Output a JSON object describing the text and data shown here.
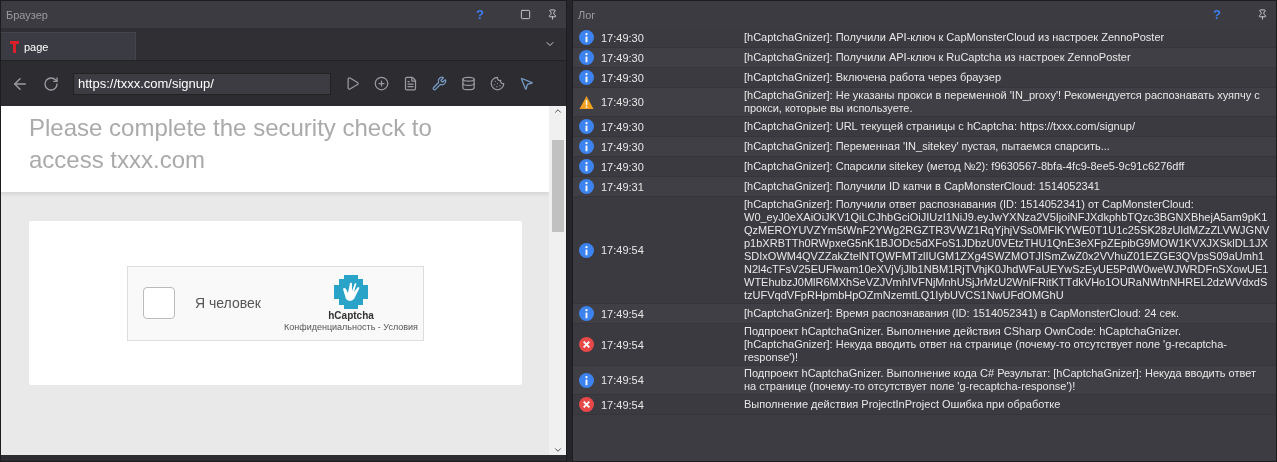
{
  "browser_panel": {
    "title": "Браузер",
    "help": "?",
    "tabs": [
      {
        "label": "page",
        "selected": true
      }
    ],
    "address": "https://txxx.com/signup/",
    "page": {
      "heading_cut": "Please complete the security check to",
      "heading": "access txxx.com",
      "captcha": {
        "checked": false,
        "label": "Я человек",
        "brand": "hCaptcha",
        "links": "Конфиденциальность - Условия"
      }
    }
  },
  "log_panel": {
    "title": "Лог",
    "help": "?",
    "entries": [
      {
        "kind": "info",
        "time": "17:49:30",
        "message": "[hCaptchaGnizer]: Получили API-ключ к CapMonsterCloud из настроек ZennoPoster"
      },
      {
        "kind": "info",
        "time": "17:49:30",
        "message": "[hCaptchaGnizer]: Получили API-ключ к RuCaptcha из настроек ZennoPoster"
      },
      {
        "kind": "info",
        "time": "17:49:30",
        "message": "[hCaptchaGnizer]: Включена работа через браузер"
      },
      {
        "kind": "warning",
        "time": "17:49:30",
        "message": "[hCaptchaGnizer]: Не указаны прокси в переменной 'IN_proxy'! Рекомендуется распознавать хуяпчу с прокси, которые вы используете."
      },
      {
        "kind": "info",
        "time": "17:49:30",
        "message": "[hCaptchaGnizer]: URL текущей страницы с hCaptcha: https://txxx.com/signup/"
      },
      {
        "kind": "info",
        "time": "17:49:30",
        "message": "[hCaptchaGnizer]: Переменная 'IN_sitekey' пустая, пытаемся спарсить..."
      },
      {
        "kind": "info",
        "time": "17:49:30",
        "message": "[hCaptchaGnizer]: Спарсили sitekey (метод №2): f9630567-8bfa-4fc9-8ee5-9c91c6276dff"
      },
      {
        "kind": "info",
        "time": "17:49:31",
        "message": "[hCaptchaGnizer]: Получили ID капчи в CapMonsterCloud: 1514052341"
      },
      {
        "kind": "info",
        "time": "17:49:54",
        "message": "[hCaptchaGnizer]: Получили ответ распознавания (ID: 1514052341) от CapMonsterCloud: W0_eyJ0eXAiOiJKV1QiLCJhbGciOiJIUzI1NiJ9.eyJwYXNza2V5IjoiNFJXdkphbTQzc3BGNXBhejA5am9pK1QzMERОYUVZYm5tWnF2YWg2RGZTR3VWZ1RqYjhjVSs0MFlKYWE0T1U1c25SK28zUldMZzZLVWJGNVp1bXRBTTh0RWpxeG5nK1BJODc5dXFoS1JDbzU0VEtzTHU1QnE3eXFpZEpibG9MOW1KVXJXSklDL1JXSDIxOWM4QVZZakZtelNTQWFMTzlIUGM1ZXg4SWZMOTJISmZwZ0x2VVhuZ01EZGE3QVpsS09aUmh1N2l4cTFsV25EUFlwam10eXVjVjJlb1NBM1RjTVhjK0JhdWFaUEYwSzEyUE5PdW0weWJWRDFnSXowUE1WTEhubzJ0MlR6MXhSeVZJVmhIVFNjMnhUSjJrMzU2WnlFRitKTTdkVHo1OURaNWtnNHREL2dzWVdxdStzUFVqdVFpRHpmbHpOZmNzemtLQ1IybUVCS1NwUFdOMGhU"
      },
      {
        "kind": "info",
        "time": "17:49:54",
        "message": "[hCaptchaGnizer]: Время распознавания (ID: 1514052341) в CapMonsterCloud: 24 сек."
      },
      {
        "kind": "error",
        "time": "17:49:54",
        "message": "Подпроект hCaptchaGnizer. Выполнение действия CSharp OwnCode: hCaptchaGnizer. [hCaptchaGnizer]: Некуда вводить ответ на странице (почему-то отсутствует поле 'g-recaptcha-response')!"
      },
      {
        "kind": "info",
        "time": "17:49:54",
        "message": "Подпроект hCaptchaGnizer. Выполнение кода C#  Результат: [hCaptchaGnizer]: Некуда вводить ответ на странице (почему-то отсутствует поле 'g-recaptcha-response')!"
      },
      {
        "kind": "error",
        "time": "17:49:54",
        "message": "Выполнение действия ProjectInProject Ошибка при обработке"
      }
    ]
  }
}
